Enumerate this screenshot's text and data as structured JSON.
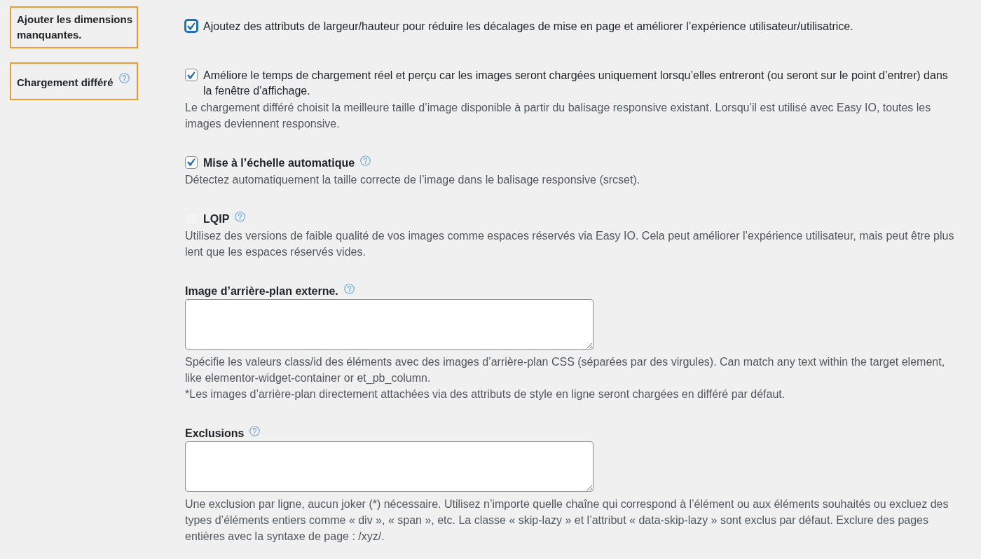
{
  "settings": [
    {
      "label": "Ajouter les dimensions manquantes.",
      "highlighted": true,
      "help": false,
      "options": [
        {
          "kind": "checkbox",
          "checked": true,
          "focused": true,
          "disabled": false,
          "text": "Ajoutez des attributs de largeur/hauteur pour réduire les décalages de mise en page et améliorer l’expérience utilisateur/utilisatrice."
        }
      ]
    },
    {
      "label": "Chargement différé",
      "highlighted": true,
      "help": true,
      "options": [
        {
          "kind": "checkbox",
          "checked": true,
          "focused": false,
          "disabled": false,
          "text": "Améliore le temps de chargement réel et perçu car les images seront chargées uniquement lorsqu’elles entreront (ou seront sur le point d’entrer) dans la fenêtre d’affichage.",
          "description": [
            "Le chargement différé choisit la meilleure taille d’image disponible à partir du balisage responsive existant. Lorsqu’il est utilisé avec Easy IO, toutes les images deviennent responsive."
          ]
        },
        {
          "kind": "checkbox",
          "checked": true,
          "focused": false,
          "disabled": false,
          "title": "Mise à l’échelle automatique",
          "help": true,
          "description": [
            "Détectez automatiquement la taille correcte de l’image dans le balisage responsive (srcset)."
          ]
        },
        {
          "kind": "checkbox",
          "checked": false,
          "focused": false,
          "disabled": true,
          "title": "LQIP",
          "help": true,
          "description": [
            "Utilisez des versions de faible qualité de vos images comme espaces réservés via Easy IO. Cela peut améliorer l’expérience utilisateur, mais peut être plus lent que les espaces réservés vides."
          ]
        },
        {
          "kind": "textarea",
          "title": "Image d’arrière-plan externe.",
          "help": true,
          "description": [
            "Spécifie les valeurs class/id des éléments avec des images d’arrière-plan CSS (séparées par des virgules). Can match any text within the target element, like elementor-widget-container or et_pb_column.",
            "*Les images d’arrière-plan directement attachées via des attributs de style en ligne seront chargées en différé par défaut."
          ]
        },
        {
          "kind": "textarea",
          "title": "Exclusions",
          "help": true,
          "description": [
            "Une exclusion par ligne, aucun joker (*) nécessaire. Utilisez n’importe quelle chaîne qui correspond à l’élément ou aux éléments souhaités ou excluez des types d’éléments entiers comme « div », « span », etc. La classe « skip-lazy » et l’attribut « data-skip-lazy » sont exclus par défaut. Exclure des pages entières avec la syntaxe de page : /xyz/."
          ]
        }
      ]
    }
  ]
}
